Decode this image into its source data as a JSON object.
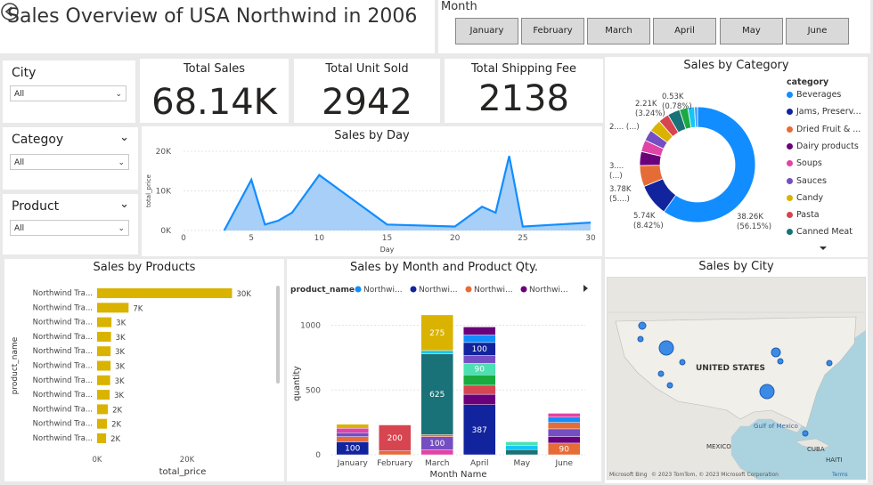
{
  "header": {
    "title": "Sales Overview of USA Northwind in 2006",
    "back_icon": "back-arrow-icon"
  },
  "month_slicer": {
    "label": "Month",
    "months": [
      "January",
      "February",
      "March",
      "April",
      "May",
      "June"
    ]
  },
  "filters": {
    "city": {
      "label": "City",
      "value": "All"
    },
    "category": {
      "label": "Categoy",
      "value": "All"
    },
    "product": {
      "label": "Product",
      "value": "All"
    }
  },
  "kpis": {
    "total_sales": {
      "label": "Total Sales",
      "value": "68.14K"
    },
    "total_units": {
      "label": "Total Unit Sold",
      "value": "2942"
    },
    "total_shipping": {
      "label": "Total Shipping Fee",
      "value": "2138"
    }
  },
  "chart_data": [
    {
      "id": "sales_by_day",
      "type": "area",
      "title": "Sales by Day",
      "xlabel": "Day",
      "ylabel": "total_price",
      "xlim": [
        0,
        30
      ],
      "ylim": [
        0,
        20000
      ],
      "xticks": [
        "0",
        "5",
        "10",
        "15",
        "20",
        "25",
        "30"
      ],
      "yticks": [
        "0K",
        "10K",
        "20K"
      ],
      "color": "#118dff",
      "x": [
        3,
        5,
        6,
        7,
        8,
        10,
        15,
        20,
        22,
        23,
        24,
        25,
        30
      ],
      "y": [
        0,
        12800,
        1500,
        2500,
        4500,
        14000,
        1500,
        1000,
        6000,
        4500,
        18800,
        1000,
        2000
      ]
    },
    {
      "id": "sales_by_category",
      "type": "pie",
      "title": "Sales by Category",
      "legend_title": "category",
      "legend_position": "right",
      "categories": [
        "Beverages",
        "Jams, Preserv...",
        "Dried Fruit & ...",
        "Dairy products",
        "Soups",
        "Sauces",
        "Candy",
        "Pasta",
        "Canned Meat"
      ],
      "colors": [
        "#118dff",
        "#12239e",
        "#e66c37",
        "#6b007b",
        "#e044a7",
        "#744ec2",
        "#d9b300",
        "#d64550",
        "#197278"
      ],
      "values": [
        38260,
        5740,
        3780,
        2500,
        2100,
        2000,
        2200,
        1900,
        2210,
        1500,
        1200,
        530
      ],
      "extra_colors": [
        "#1aab40",
        "#15c6f4",
        "#4092ff"
      ],
      "labels": {
        "beverages": "38.26K\n(56.15%)",
        "jams": "5.74K\n(8.42%)",
        "dried": "3.78K\n(5....)",
        "dairy": "3....\n(...)",
        "soups": "2.... (...)",
        "canned": "2.21K\n(3.24%)",
        "small": "0.53K\n(0.78%)"
      }
    },
    {
      "id": "sales_by_products",
      "type": "bar",
      "title": "Sales by Products",
      "xlabel": "total_price",
      "ylabel": "product_name",
      "xticks": [
        "0K",
        "20K"
      ],
      "xlim": [
        0,
        40000
      ],
      "color": "#d9b300",
      "categories": [
        "Northwind Tra...",
        "Northwind Tra...",
        "Northwind Tra...",
        "Northwind Tra...",
        "Northwind Tra...",
        "Northwind Tra...",
        "Northwind Tra...",
        "Northwind Tra...",
        "Northwind Tra...",
        "Northwind Tra...",
        "Northwind Tra..."
      ],
      "values": [
        30000,
        7000,
        3200,
        3100,
        3000,
        3000,
        2900,
        2800,
        2400,
        2200,
        2000
      ],
      "data_labels": [
        "30K",
        "7K",
        "3K",
        "3K",
        "3K",
        "3K",
        "3K",
        "3K",
        "2K",
        "2K",
        "2K"
      ]
    },
    {
      "id": "sales_by_month_qty",
      "type": "bar",
      "title": "Sales by Month and Product Qty.",
      "xlabel": "Month Name",
      "ylabel": "quantity",
      "ylim": [
        0,
        1100
      ],
      "yticks": [
        "0",
        "500",
        "1000"
      ],
      "legend_title": "product_name",
      "legend": [
        "Northwi...",
        "Northwi...",
        "Northwi...",
        "Northwi..."
      ],
      "legend_colors": [
        "#118dff",
        "#12239e",
        "#e66c37",
        "#6b007b"
      ],
      "categories": [
        "January",
        "February",
        "March",
        "April",
        "May",
        "June"
      ],
      "stacks": [
        [
          {
            "v": 100,
            "c": "#12239e",
            "label": "100"
          },
          {
            "v": 40,
            "c": "#e66c37"
          },
          {
            "v": 30,
            "c": "#744ec2"
          },
          {
            "v": 35,
            "c": "#e044a7"
          },
          {
            "v": 30,
            "c": "#d9b300"
          }
        ],
        [
          {
            "v": 30,
            "c": "#e66c37"
          },
          {
            "v": 200,
            "c": "#d64550",
            "label": "200"
          }
        ],
        [
          {
            "v": 40,
            "c": "#e044a7"
          },
          {
            "v": 100,
            "c": "#744ec2",
            "label": "100"
          },
          {
            "v": 15,
            "c": "#e66c37"
          },
          {
            "v": 625,
            "c": "#197278",
            "label": "625"
          },
          {
            "v": 25,
            "c": "#15c6f4"
          },
          {
            "v": 275,
            "c": "#d9b300",
            "label": "275"
          }
        ],
        [
          {
            "v": 387,
            "c": "#12239e",
            "label": "387"
          },
          {
            "v": 80,
            "c": "#6b007b"
          },
          {
            "v": 70,
            "c": "#d64550"
          },
          {
            "v": 80,
            "c": "#1aab40"
          },
          {
            "v": 90,
            "c": "#4ce0b3",
            "label": "90"
          },
          {
            "v": 60,
            "c": "#744ec2"
          },
          {
            "v": 100,
            "c": "#12239e",
            "label": "100"
          },
          {
            "v": 60,
            "c": "#118dff"
          },
          {
            "v": 60,
            "c": "#6b007b"
          }
        ],
        [
          {
            "v": 40,
            "c": "#197278"
          },
          {
            "v": 30,
            "c": "#15c6f4"
          },
          {
            "v": 30,
            "c": "#4ce0b3"
          }
        ],
        [
          {
            "v": 90,
            "c": "#e66c37",
            "label": "90"
          },
          {
            "v": 50,
            "c": "#6b007b"
          },
          {
            "v": 60,
            "c": "#744ec2"
          },
          {
            "v": 50,
            "c": "#e66c37"
          },
          {
            "v": 40,
            "c": "#118dff"
          },
          {
            "v": 30,
            "c": "#e044a7"
          }
        ]
      ]
    }
  ],
  "map": {
    "title": "Sales by City",
    "labels": {
      "usa": "UNITED STATES",
      "mexico": "MEXICO",
      "gulf": "Gulf of\nMexico",
      "cuba": "CUBA",
      "haiti": "HAITI"
    },
    "attribution": "© 2023 TomTom, © 2023 Microsoft Corporation",
    "terms": "Terms",
    "bing": "Microsoft Bing"
  }
}
